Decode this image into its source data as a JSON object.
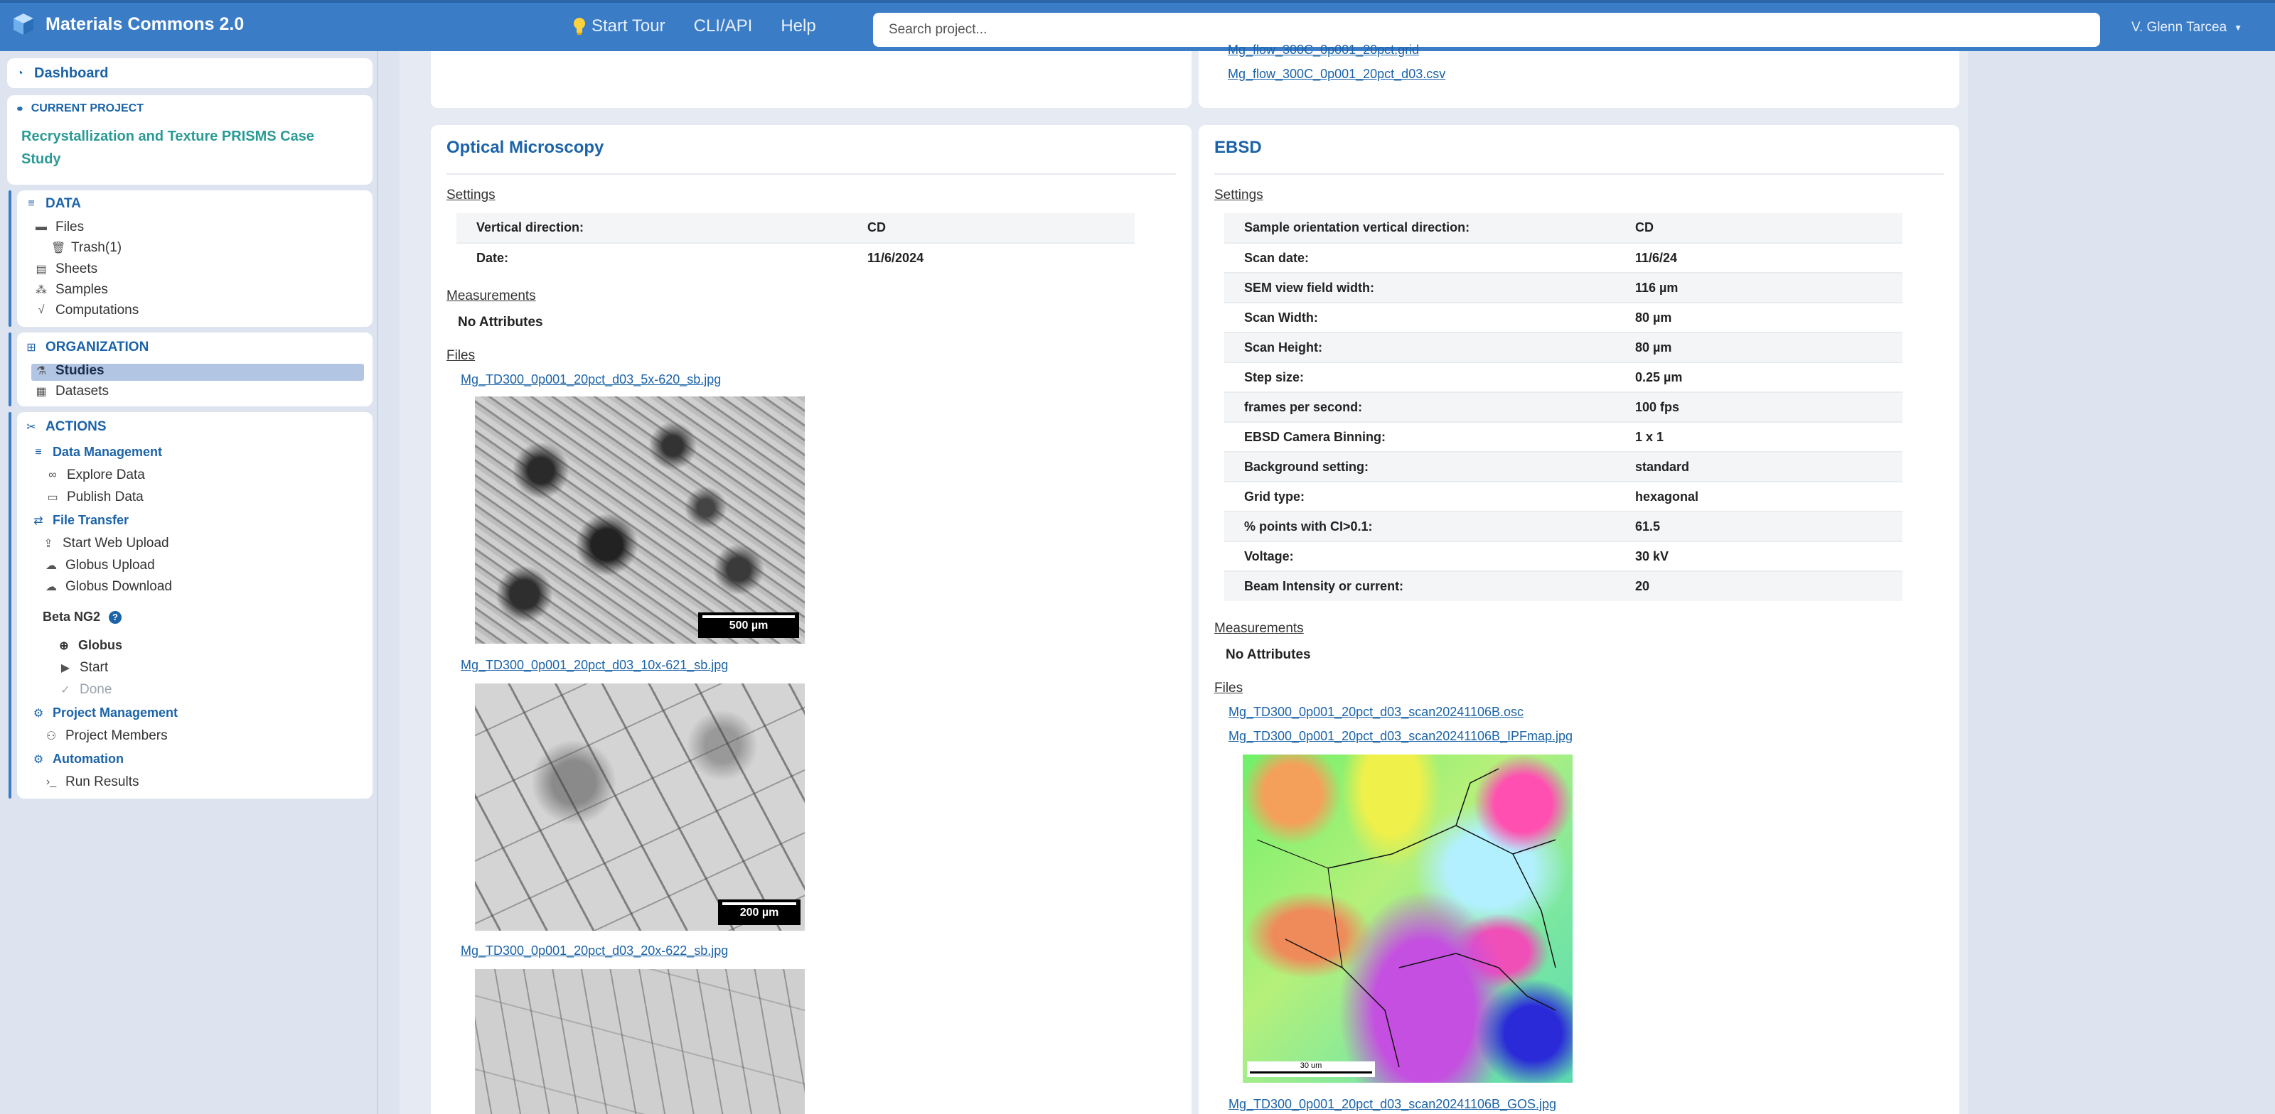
{
  "app": {
    "title": "Materials Commons 2.0"
  },
  "nav": {
    "start_tour": "Start Tour",
    "cli_api": "CLI/API",
    "help": "Help"
  },
  "search": {
    "placeholder": "Search project..."
  },
  "user": {
    "name": "V. Glenn Tarcea"
  },
  "sidebar": {
    "dashboard": "Dashboard",
    "current_project_label": "CURRENT PROJECT",
    "project_name": "Recrystallization and Texture PRISMS Case Study",
    "data": {
      "heading": "DATA",
      "files": "Files",
      "trash": "Trash(1)",
      "sheets": "Sheets",
      "samples": "Samples",
      "computations": "Computations"
    },
    "organization": {
      "heading": "ORGANIZATION",
      "studies": "Studies",
      "datasets": "Datasets"
    },
    "actions": {
      "heading": "ACTIONS",
      "data_management": "Data Management",
      "explore_data": "Explore Data",
      "publish_data": "Publish Data",
      "file_transfer": "File Transfer",
      "start_web_upload": "Start Web Upload",
      "globus_upload": "Globus Upload",
      "globus_download": "Globus Download",
      "beta_ng2": "Beta NG2",
      "globus": "Globus",
      "start": "Start",
      "done": "Done",
      "project_management": "Project Management",
      "project_members": "Project Members",
      "automation": "Automation",
      "run_results": "Run Results"
    }
  },
  "top_right_files": [
    "Mg_flow_300C_0p001_20pct.grid",
    "Mg_flow_300C_0p001_20pct_d03.csv"
  ],
  "optical": {
    "title": "Optical Microscopy",
    "settings_label": "Settings",
    "settings": [
      {
        "key": "Vertical direction:",
        "value": "CD"
      },
      {
        "key": "Date:",
        "value": "11/6/2024"
      }
    ],
    "measurements_label": "Measurements",
    "no_attributes": "No Attributes",
    "files_label": "Files",
    "files": [
      {
        "name": "Mg_TD300_0p001_20pct_d03_5x-620_sb.jpg",
        "scale": "500 µm"
      },
      {
        "name": "Mg_TD300_0p001_20pct_d03_10x-621_sb.jpg",
        "scale": "200 µm"
      },
      {
        "name": "Mg_TD300_0p001_20pct_d03_20x-622_sb.jpg",
        "scale": ""
      }
    ]
  },
  "ebsd": {
    "title": "EBSD",
    "settings_label": "Settings",
    "settings": [
      {
        "key": "Sample orientation vertical direction:",
        "value": "CD"
      },
      {
        "key": "Scan date:",
        "value": "11/6/24"
      },
      {
        "key": "SEM view field width:",
        "value": "116 µm"
      },
      {
        "key": "Scan Width:",
        "value": "80 µm"
      },
      {
        "key": "Scan Height:",
        "value": "80 µm"
      },
      {
        "key": "Step size:",
        "value": "0.25 µm"
      },
      {
        "key": "frames per second:",
        "value": "100 fps"
      },
      {
        "key": "EBSD Camera Binning:",
        "value": "1 x 1"
      },
      {
        "key": "Background setting:",
        "value": "standard"
      },
      {
        "key": "Grid type:",
        "value": "hexagonal"
      },
      {
        "key": "% points with CI>0.1:",
        "value": "61.5"
      },
      {
        "key": "Voltage:",
        "value": "30 kV"
      },
      {
        "key": "Beam Intensity or current:",
        "value": "20"
      }
    ],
    "measurements_label": "Measurements",
    "no_attributes": "No Attributes",
    "files_label": "Files",
    "files": [
      "Mg_TD300_0p001_20pct_d03_scan20241106B.osc",
      "Mg_TD300_0p001_20pct_d03_scan20241106B_IPFmap.jpg",
      "Mg_TD300_0p001_20pct_d03_scan20241106B_GOS.jpg"
    ],
    "ipf_scale": "30 um"
  }
}
